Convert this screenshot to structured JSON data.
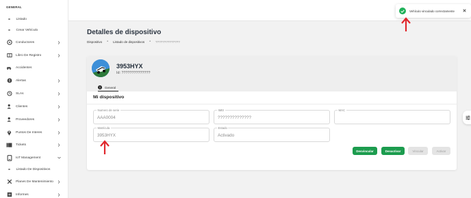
{
  "sidebar": {
    "section_label": "GENERAL",
    "items": [
      {
        "label": "Listado",
        "icon": "bullet",
        "chevron": false
      },
      {
        "label": "Crear Vehículo",
        "icon": "bullet",
        "chevron": false
      },
      {
        "label": "Conductores",
        "icon": "steering-wheel-icon",
        "chevron": true
      },
      {
        "label": "Libro De Registro",
        "icon": "book-icon",
        "chevron": true
      },
      {
        "label": "Accidentes",
        "icon": "car-crash-icon",
        "chevron": false
      },
      {
        "label": "Alertas",
        "icon": "alert-icon",
        "chevron": true
      },
      {
        "label": "SLAs",
        "icon": "sla-icon",
        "chevron": true
      },
      {
        "label": "Clientes",
        "icon": "clients-icon",
        "chevron": true
      },
      {
        "label": "Proveedores",
        "icon": "providers-icon",
        "chevron": true
      },
      {
        "label": "Puntos De Interes",
        "icon": "pin-icon",
        "chevron": true
      },
      {
        "label": "Tickets",
        "icon": "ticket-icon",
        "chevron": true
      },
      {
        "label": "IoT Management",
        "icon": "iot-icon",
        "chevron": true
      },
      {
        "label": "Listado De Dispositivos",
        "icon": "bullet",
        "chevron": false
      },
      {
        "label": "Planes De Mantenimiento",
        "icon": "wrench-icon",
        "chevron": true
      },
      {
        "label": "Informes",
        "icon": "report-icon",
        "chevron": true
      }
    ]
  },
  "toast": {
    "message": "Vehículo vinculado correctamente",
    "color": "#20b15a"
  },
  "page": {
    "title": "Detalles de dispositivo",
    "breadcrumb": [
      "Dispositivo",
      "Listado de dispositivos",
      "??????????????"
    ]
  },
  "device": {
    "plate": "3953HYX",
    "id_line": "Id: ??????????????",
    "tab_label": "General"
  },
  "form": {
    "section_title": "Mi dispositivo",
    "fields": [
      {
        "label": "Numero de serie",
        "value": "AAA0004"
      },
      {
        "label": "IMEI",
        "value": "??????????????"
      },
      {
        "label": "MAC",
        "value": ""
      },
      {
        "label": "Matrícula",
        "value": "3953HYX"
      },
      {
        "label": "Estado",
        "value": "Activado"
      }
    ]
  },
  "buttons": {
    "unlink": "Desvincular",
    "deactivate": "Desactivar",
    "link": "Vincular",
    "activate": "Activar"
  },
  "colors": {
    "accent_green": "#1c9c4e",
    "arrow_red": "#e0262b"
  }
}
